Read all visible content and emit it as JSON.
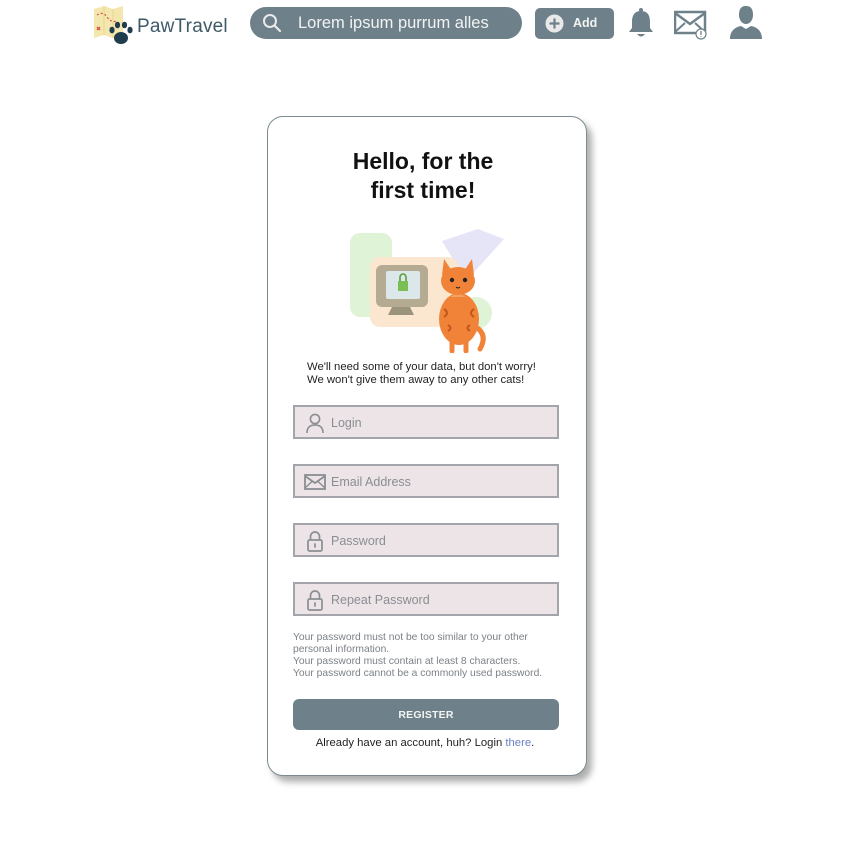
{
  "header": {
    "brand_name": "PawTravel",
    "search_placeholder": "Lorem ipsum purrum alles",
    "add_label": "Add",
    "accent_color": "#6e818a",
    "brand_color": "#3d5a66",
    "icons": [
      "map-paw-logo-icon",
      "search-icon",
      "plus-circle-icon",
      "bell-icon",
      "mail-alert-icon",
      "user-icon"
    ]
  },
  "register_card": {
    "title_line1": "Hello, for the",
    "title_line2": "first time!",
    "intro_line1": "We'll need some of your data, but don't worry!",
    "intro_line2": "We won't give them away to any other cats!",
    "fields": [
      {
        "placeholder": "Login",
        "icon": "user-icon"
      },
      {
        "placeholder": "Email Address",
        "icon": "envelope-icon"
      },
      {
        "placeholder": "Password",
        "icon": "lock-icon"
      },
      {
        "placeholder": "Repeat Password",
        "icon": "lock-icon"
      }
    ],
    "password_hints": [
      "Your password must not be too similar to your other",
      "personal information.",
      "Your password must contain at least 8 characters.",
      "Your password cannot be a commonly used password."
    ],
    "register_label": "REGISTER",
    "login_prompt": "Already have an account, huh? Login ",
    "login_link": "there",
    "login_suffix": ".",
    "link_color": "#6b7fc6"
  }
}
